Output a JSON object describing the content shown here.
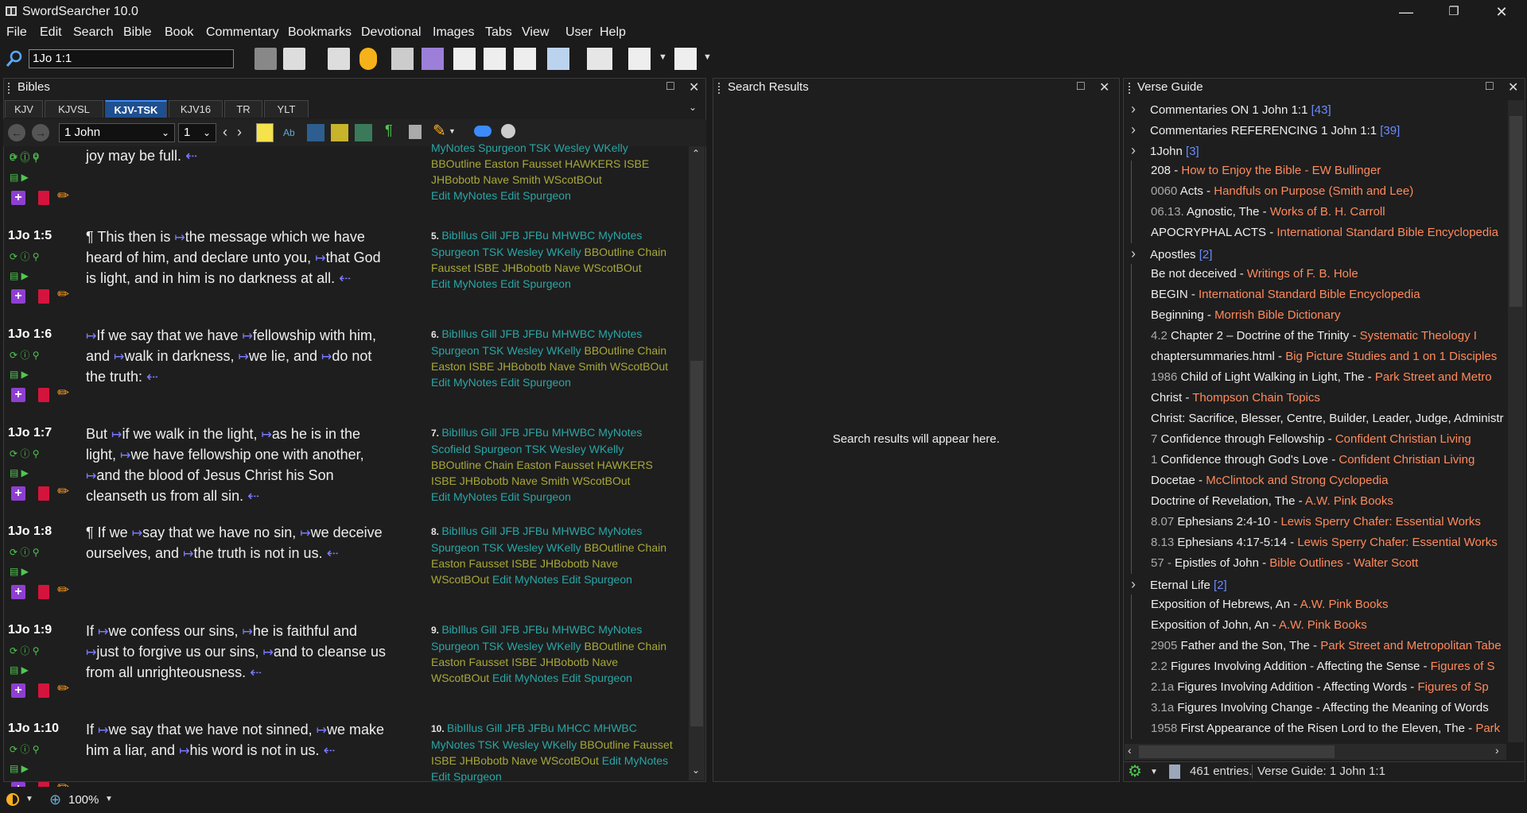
{
  "window": {
    "title": "SwordSearcher 10.0"
  },
  "menu": [
    "File",
    "Edit",
    "Search",
    "Bible",
    "Book",
    "Commentary",
    "Bookmarks",
    "Devotional",
    "Images",
    "Tabs",
    "View",
    "User",
    "Help"
  ],
  "toolbar": {
    "reference": "1Jo 1:1"
  },
  "bibles_panel": {
    "title": "Bibles",
    "tabs": [
      "KJV",
      "KJVSL",
      "KJV-TSK",
      "KJV16",
      "TR",
      "YLT"
    ],
    "active_tab": "KJV-TSK",
    "book": "1 John",
    "chapter": "1",
    "top_fragment": {
      "text": "joy may be full.",
      "xref_lines": [
        "MyNotes Spurgeon TSK Wesley WKelly",
        "BBOutline Easton Fausset HAWKERS ISBE",
        "JHBobotb Nave Smith WScotBOut",
        "Edit MyNotes Edit Spurgeon"
      ]
    },
    "verses": [
      {
        "ref": "1Jo 1:5",
        "lines": [
          "¶ This then is ↦the message which we have",
          "heard of him, and declare unto you, ↦that God",
          "is light, and in him is no darkness at all. ⇠"
        ],
        "xnum": "5.",
        "xref_lines": [
          "BibIllus Gill JFB JFBu MHWBC MyNotes",
          "Spurgeon TSK Wesley WKelly BBOutline Chain",
          "Fausset ISBE JHBobotb Nave WScotBOut",
          "Edit MyNotes Edit Spurgeon"
        ]
      },
      {
        "ref": "1Jo 1:6",
        "lines": [
          "↦If we say that we have ↦fellowship with him,",
          "and ↦walk in darkness, ↦we lie, and ↦do not",
          "the truth: ⇠"
        ],
        "xnum": "6.",
        "xref_lines": [
          "BibIllus Gill JFB JFBu MHWBC MyNotes",
          "Spurgeon TSK Wesley WKelly BBOutline Chain",
          "Easton ISBE JHBobotb Nave Smith WScotBOut",
          "Edit MyNotes Edit Spurgeon"
        ]
      },
      {
        "ref": "1Jo 1:7",
        "lines": [
          "But ↦if we walk in the light, ↦as he is in the",
          "light, ↦we have fellowship one with another,",
          "↦and the blood of Jesus Christ his Son",
          "cleanseth us from all sin. ⇠"
        ],
        "xnum": "7.",
        "xref_lines": [
          "BibIllus Gill JFB JFBu MHWBC MyNotes",
          "Scofield Spurgeon TSK Wesley WKelly",
          "BBOutline Chain Easton Fausset HAWKERS",
          "ISBE JHBobotb Nave Smith WScotBOut",
          "Edit MyNotes Edit Spurgeon"
        ]
      },
      {
        "ref": "1Jo 1:8",
        "lines": [
          "¶ If we ↦say that we have no sin, ↦we deceive",
          "ourselves, and ↦the truth is not in us. ⇠"
        ],
        "xnum": "8.",
        "xref_lines": [
          "BibIllus Gill JFB JFBu MHWBC MyNotes",
          "Spurgeon TSK Wesley WKelly BBOutline Chain",
          "Easton Fausset ISBE JHBobotb Nave",
          "WScotBOut Edit MyNotes Edit Spurgeon"
        ]
      },
      {
        "ref": "1Jo 1:9",
        "lines": [
          "If ↦we confess our sins, ↦he is faithful and",
          "↦just to forgive us our sins, ↦and to cleanse us",
          "from all unrighteousness. ⇠"
        ],
        "xnum": "9.",
        "xref_lines": [
          "BibIllus Gill JFB JFBu MHWBC MyNotes",
          "Spurgeon TSK Wesley WKelly BBOutline Chain",
          "Easton Fausset ISBE JHBobotb Nave",
          "WScotBOut Edit MyNotes Edit Spurgeon"
        ]
      },
      {
        "ref": "1Jo 1:10",
        "lines": [
          "If ↦we say that we have not sinned, ↦we make",
          "him a liar, and ↦his word is not in us. ⇠"
        ],
        "xnum": "10.",
        "xref_lines": [
          "BibIllus Gill JFB JFBu MHCC MHWBC",
          "MyNotes TSK Wesley WKelly BBOutline Fausset",
          "ISBE JHBobotb Nave WScotBOut Edit MyNotes",
          "Edit Spurgeon"
        ]
      }
    ]
  },
  "search_panel": {
    "title": "Search Results",
    "placeholder": "Search results will appear here."
  },
  "verse_guide": {
    "title": "Verse Guide",
    "rows": [
      {
        "expand": true,
        "pfx": "",
        "text": "Commentaries ON 1 John 1:1 ",
        "src": "",
        "cnt": "[43]"
      },
      {
        "expand": true,
        "pfx": "",
        "text": "Commentaries REFERENCING 1 John 1:1 ",
        "src": "",
        "cnt": "[39]"
      },
      {
        "expand": true,
        "pfx": "",
        "text": "1John ",
        "src": "",
        "cnt": "[3]"
      },
      {
        "expand": false,
        "pfx": "",
        "text": "208 - ",
        "src": "How to Enjoy the Bible - EW Bullinger",
        "cnt": ""
      },
      {
        "expand": false,
        "pfx": "0060 ",
        "text": "Acts - ",
        "src": "Handfuls on Purpose (Smith and Lee)",
        "cnt": ""
      },
      {
        "expand": false,
        "pfx": "06.13. ",
        "text": "Agnostic, The - ",
        "src": "Works of B. H. Carroll",
        "cnt": ""
      },
      {
        "expand": false,
        "pfx": "",
        "text": "APOCRYPHAL ACTS - ",
        "src": "International Standard Bible Encyclopedia",
        "cnt": ""
      },
      {
        "expand": true,
        "pfx": "",
        "text": "Apostles ",
        "src": "",
        "cnt": "[2]"
      },
      {
        "expand": false,
        "pfx": "",
        "text": "Be not deceived - ",
        "src": "Writings of F. B. Hole",
        "cnt": ""
      },
      {
        "expand": false,
        "pfx": "",
        "text": "BEGIN - ",
        "src": "International Standard Bible Encyclopedia",
        "cnt": ""
      },
      {
        "expand": false,
        "pfx": "",
        "text": "Beginning - ",
        "src": "Morrish Bible Dictionary",
        "cnt": ""
      },
      {
        "expand": false,
        "pfx": "4.2 ",
        "text": "Chapter 2 – Doctrine of the Trinity - ",
        "src": "Systematic Theology I",
        "cnt": ""
      },
      {
        "expand": false,
        "pfx": "",
        "text": "chaptersummaries.html - ",
        "src": "Big Picture Studies and 1 on 1 Disciples",
        "cnt": ""
      },
      {
        "expand": false,
        "pfx": "1986 ",
        "text": "Child of Light Walking in Light, The - ",
        "src": "Park Street and Metro",
        "cnt": ""
      },
      {
        "expand": false,
        "pfx": "",
        "text": "Christ - ",
        "src": "Thompson Chain Topics",
        "cnt": ""
      },
      {
        "expand": false,
        "pfx": "",
        "text": "Christ: Sacrifice, Blesser, Centre, Builder, Leader, Judge, Administr",
        "src": "",
        "cnt": ""
      },
      {
        "expand": false,
        "pfx": "7 ",
        "text": "Confidence through Fellowship - ",
        "src": "Confident Christian Living",
        "cnt": ""
      },
      {
        "expand": false,
        "pfx": "1 ",
        "text": "Confidence through God's Love - ",
        "src": "Confident Christian Living",
        "cnt": ""
      },
      {
        "expand": false,
        "pfx": "",
        "text": "Docetae - ",
        "src": "McClintock and Strong Cyclopedia",
        "cnt": ""
      },
      {
        "expand": false,
        "pfx": "",
        "text": "Doctrine of Revelation, The - ",
        "src": "A.W. Pink Books",
        "cnt": ""
      },
      {
        "expand": false,
        "pfx": "8.07 ",
        "text": "Ephesians 2:4-10 - ",
        "src": "Lewis Sperry Chafer: Essential Works",
        "cnt": ""
      },
      {
        "expand": false,
        "pfx": "8.13 ",
        "text": "Ephesians 4:17-5:14 - ",
        "src": "Lewis Sperry Chafer: Essential Works",
        "cnt": ""
      },
      {
        "expand": false,
        "pfx": "57 - ",
        "text": "Epistles of John - ",
        "src": "Bible Outlines - Walter Scott",
        "cnt": ""
      },
      {
        "expand": true,
        "pfx": "",
        "text": "Eternal Life ",
        "src": "",
        "cnt": "[2]"
      },
      {
        "expand": false,
        "pfx": "",
        "text": "Exposition of Hebrews, An - ",
        "src": "A.W. Pink Books",
        "cnt": ""
      },
      {
        "expand": false,
        "pfx": "",
        "text": "Exposition of John, An - ",
        "src": "A.W. Pink Books",
        "cnt": ""
      },
      {
        "expand": false,
        "pfx": "2905 ",
        "text": "Father and the Son, The - ",
        "src": "Park Street and Metropolitan Tabe",
        "cnt": ""
      },
      {
        "expand": false,
        "pfx": "2.2 ",
        "text": "Figures Involving Addition - Affecting the Sense - ",
        "src": "Figures of S",
        "cnt": ""
      },
      {
        "expand": false,
        "pfx": "2.1a ",
        "text": "Figures Involving Addition - Affecting Words - ",
        "src": "Figures of Sp",
        "cnt": ""
      },
      {
        "expand": false,
        "pfx": "3.1a ",
        "text": "Figures Involving Change - Affecting the Meaning of Words",
        "src": "",
        "cnt": ""
      },
      {
        "expand": false,
        "pfx": "1958 ",
        "text": "First Appearance of the Risen Lord to the Eleven, The - ",
        "src": "Park",
        "cnt": ""
      }
    ],
    "entries": "461 entries.",
    "status": "Verse Guide: 1 John 1:1"
  },
  "statusbar": {
    "zoom": "100%"
  },
  "colors": {
    "accent_tab": "#1e4f8f",
    "xref": "#2aa6a6",
    "xref_alt": "#a8a83a",
    "source": "#ff8a5c",
    "count": "#6a8cff"
  }
}
